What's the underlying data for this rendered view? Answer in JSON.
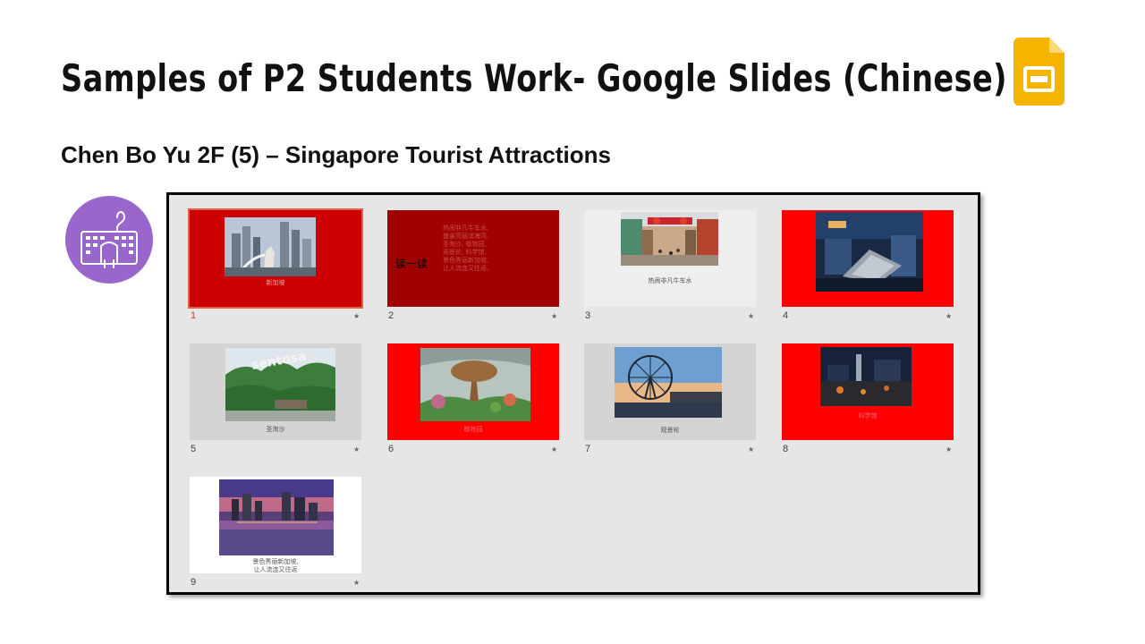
{
  "page": {
    "title": "Samples of P2 Students Work- Google Slides (Chinese)",
    "subtitle": "Chen Bo Yu 2F (5) – Singapore Tourist Attractions"
  },
  "icons": {
    "logo": "google-slides-icon",
    "typing": "keyboard-typing-icon"
  },
  "colors": {
    "accent_purple": "#9966cc",
    "slides_yellow": "#f4b400",
    "slide_red": "#ff0000",
    "slide_dark_red": "#a00000"
  },
  "slides": [
    {
      "num": "1",
      "caption": "新加坡",
      "selected": true
    },
    {
      "num": "2",
      "side_text": "读一读",
      "body_lines": [
        "热闹非凡牛车水,",
        "盛装亮丽滨海湾,",
        "圣淘沙, 植物园,",
        "观景轮, 科学馆,",
        "景色秀丽新加坡,",
        "让人流连又往返。"
      ]
    },
    {
      "num": "3",
      "caption": "热闹非凡牛车水"
    },
    {
      "num": "4",
      "caption": ""
    },
    {
      "num": "5",
      "caption": "圣淘沙"
    },
    {
      "num": "6",
      "caption": "植物园"
    },
    {
      "num": "7",
      "caption": "观景轮"
    },
    {
      "num": "8",
      "caption": "科学馆"
    },
    {
      "num": "9",
      "caption_lines": [
        "景色秀丽新加坡,",
        "让人流连又往返"
      ]
    }
  ],
  "star_glyph": "★"
}
